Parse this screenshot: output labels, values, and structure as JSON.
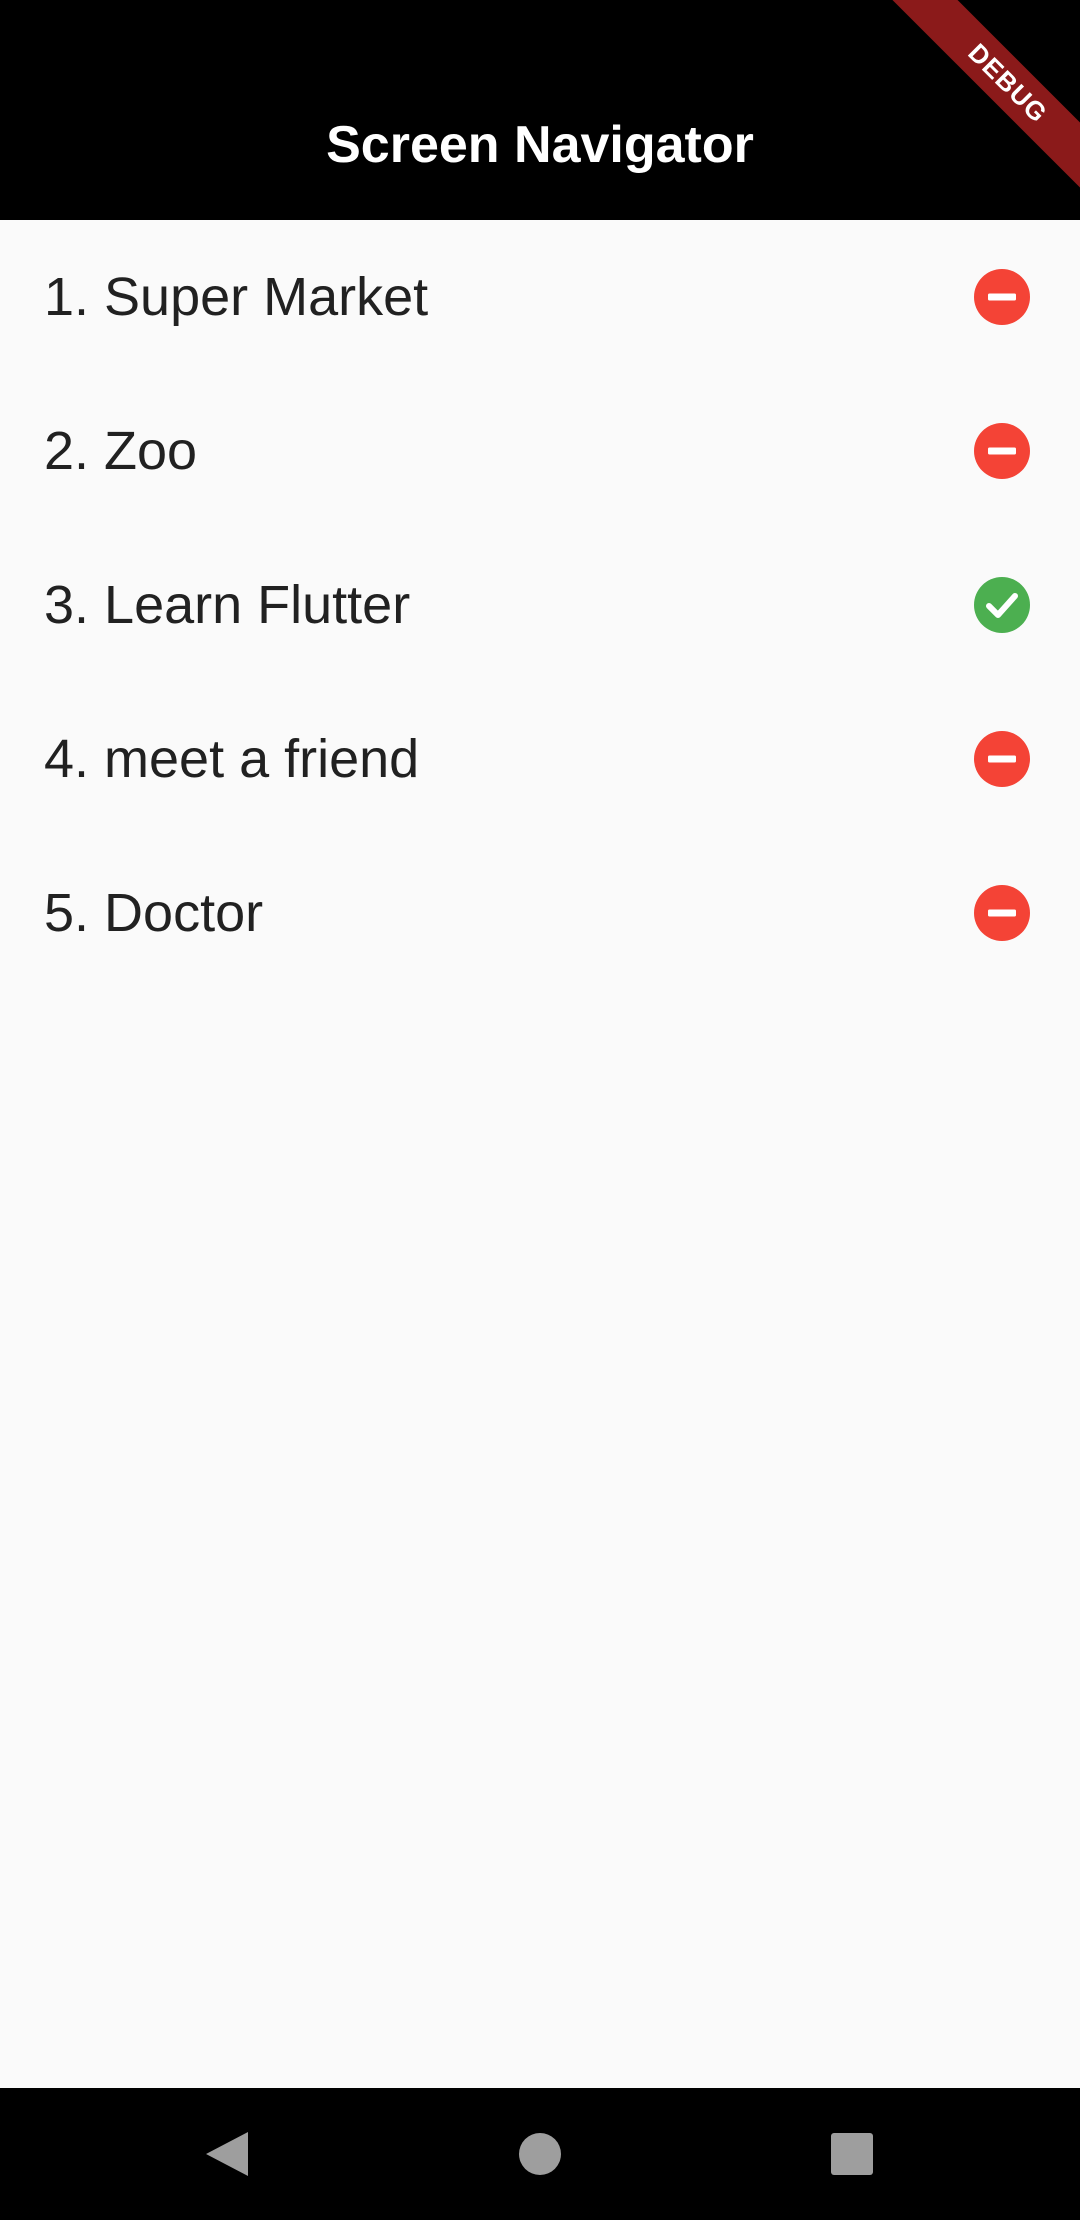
{
  "app_bar": {
    "title": "Screen Navigator",
    "debug_label": "DEBUG"
  },
  "colors": {
    "remove": "#f44336",
    "done": "#4caf50",
    "app_bar": "#000000",
    "banner": "#8b1a1a"
  },
  "items": [
    {
      "label": "1. Super Market",
      "status": "remove",
      "icon": "remove-circle-icon"
    },
    {
      "label": "2. Zoo",
      "status": "remove",
      "icon": "remove-circle-icon"
    },
    {
      "label": "3. Learn Flutter",
      "status": "done",
      "icon": "check-circle-icon"
    },
    {
      "label": "4. meet a friend",
      "status": "remove",
      "icon": "remove-circle-icon"
    },
    {
      "label": "5. Doctor",
      "status": "remove",
      "icon": "remove-circle-icon"
    }
  ],
  "nav": {
    "back": "back-icon",
    "home": "home-icon",
    "recents": "recents-icon"
  }
}
